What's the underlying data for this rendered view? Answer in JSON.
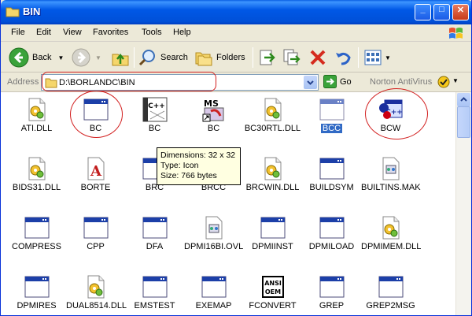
{
  "window": {
    "title": "BIN"
  },
  "title_buttons": {
    "minimize": "_",
    "maximize": "□",
    "close": "✕"
  },
  "menu": [
    "File",
    "Edit",
    "View",
    "Favorites",
    "Tools",
    "Help"
  ],
  "toolbar": {
    "back": "Back",
    "search": "Search",
    "folders": "Folders"
  },
  "address": {
    "label": "Address",
    "path": "D:\\BORLANDC\\BIN",
    "go": "Go",
    "norton": "Norton AntiVirus"
  },
  "files": [
    {
      "name": "ATI.DLL",
      "icon": "dll-icon"
    },
    {
      "name": "BC",
      "icon": "window-app-icon"
    },
    {
      "name": "BC",
      "icon": "borland-cpp-icon"
    },
    {
      "name": "BC",
      "icon": "ms-dos-shortcut-icon"
    },
    {
      "name": "BC30RTL.DLL",
      "icon": "dll-icon"
    },
    {
      "name": "BCC",
      "icon": "window-app-icon",
      "selected": true
    },
    {
      "name": "BCW",
      "icon": "borland-cpp-windows-icon"
    },
    {
      "name": "BIDS31.DLL",
      "icon": "dll-icon"
    },
    {
      "name": "BORTE",
      "icon": "font-icon"
    },
    {
      "name": "BRC",
      "icon": "window-app-icon"
    },
    {
      "name": "BRCC",
      "icon": "window-app-icon"
    },
    {
      "name": "BRCWIN.DLL",
      "icon": "dll-icon"
    },
    {
      "name": "BUILDSYM",
      "icon": "window-app-icon"
    },
    {
      "name": "BUILTINS.MAK",
      "icon": "document-icon"
    },
    {
      "name": "COMPRESS",
      "icon": "window-app-icon"
    },
    {
      "name": "CPP",
      "icon": "window-app-icon"
    },
    {
      "name": "DFA",
      "icon": "window-app-icon"
    },
    {
      "name": "DPMI16BI.OVL",
      "icon": "document-icon"
    },
    {
      "name": "DPMIINST",
      "icon": "window-app-icon"
    },
    {
      "name": "DPMILOAD",
      "icon": "window-app-icon"
    },
    {
      "name": "DPMIMEM.DLL",
      "icon": "dll-icon"
    },
    {
      "name": "DPMIRES",
      "icon": "window-app-icon"
    },
    {
      "name": "DUAL8514.DLL",
      "icon": "dll-icon"
    },
    {
      "name": "EMSTEST",
      "icon": "window-app-icon"
    },
    {
      "name": "EXEMAP",
      "icon": "window-app-icon"
    },
    {
      "name": "FCONVERT",
      "icon": "ansi-oem-icon"
    },
    {
      "name": "GREP",
      "icon": "window-app-icon"
    },
    {
      "name": "GREP2MSG",
      "icon": "window-app-icon"
    }
  ],
  "tooltip": {
    "line1": "Dimensions: 32 x 32",
    "line2": "Type: Icon",
    "line3": "Size: 766 bytes"
  },
  "icon_labels": {
    "ms": "MS",
    "cpp": "C++",
    "ansi": "ANSI",
    "oem": "OEM"
  },
  "colors": {
    "title_blue": "#0058e6",
    "selection": "#316ac5",
    "annotation_red": "#d21f1f",
    "tooltip_bg": "#ffffe1"
  }
}
